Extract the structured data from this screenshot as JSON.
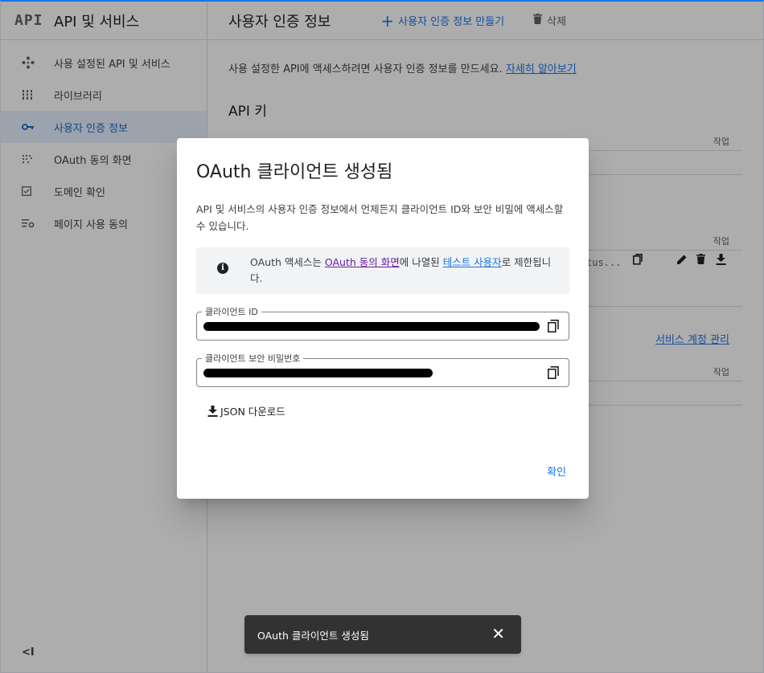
{
  "sidebar": {
    "logo": "API",
    "title": "API 및 서비스",
    "items": [
      {
        "label": "사용 설정된 API 및 서비스",
        "icon": "diamond-nodes-icon"
      },
      {
        "label": "라이브러리",
        "icon": "library-icon"
      },
      {
        "label": "사용자 인증 정보",
        "icon": "key-icon",
        "active": true
      },
      {
        "label": "OAuth 동의 화면",
        "icon": "dots-grid-icon"
      },
      {
        "label": "도메인 확인",
        "icon": "checkbox-icon"
      },
      {
        "label": "페이지 사용 동의",
        "icon": "settings-list-icon"
      }
    ],
    "collapse_label": "<I"
  },
  "header": {
    "title": "사용자 인증 정보",
    "create_label": "사용자 인증 정보 만들기",
    "delete_label": "삭제"
  },
  "main": {
    "intro_text": "사용 설정한 API에 액세스하려면 사용자 인증 정보를 만드세요.",
    "intro_link": "자세히 알아보기",
    "api_keys_title": "API 키",
    "col_action": "작업",
    "row_text": "tus...",
    "service_account_link": "서비스 계정 관리"
  },
  "dialog": {
    "title": "OAuth 클라이언트 생성됨",
    "body": "API 및 서비스의 사용자 인증 정보에서 언제든지 클라이언트 ID와 보안 비밀에 액세스할 수 있습니다.",
    "info": {
      "prefix": "OAuth 액세스는 ",
      "link1": "OAuth 동의 화면",
      "middle": "에 나열된 ",
      "link2": "테스트 사용자",
      "suffix": "로 제한됩니다."
    },
    "client_id_label": "클라이언트 ID",
    "client_secret_label": "클라이언트 보안 비밀번호",
    "download_label": "JSON 다운로드",
    "ok_label": "확인"
  },
  "snackbar": {
    "message": "OAuth 클라이언트 생성됨"
  },
  "colors": {
    "accent": "#1a73e8",
    "active_bg": "#e8f0fe",
    "snackbar_bg": "#323232"
  }
}
